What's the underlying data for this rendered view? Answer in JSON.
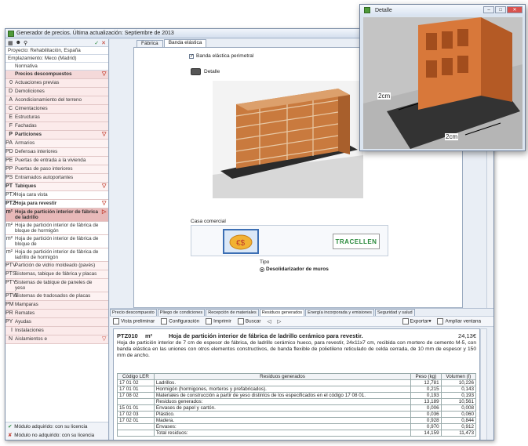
{
  "window": {
    "title": "Generador de precios. Última actualización: Septiembre de 2013"
  },
  "left": {
    "toolbar": {
      "check": "✓",
      "close": "✕"
    },
    "info": [
      {
        "label": "Proyecto: Rehabilitación, España"
      },
      {
        "label": "Emplazamiento: Meco (Madrid)"
      }
    ],
    "rows": [
      {
        "code": "",
        "label": "Normativa",
        "cls": "lvl0"
      },
      {
        "code": "",
        "label": "Precios descompuestos",
        "cls": "lvl1 bold",
        "arrow": "▽"
      },
      {
        "code": "0",
        "label": "Actuaciones previas",
        "cls": "lvl2"
      },
      {
        "code": "D",
        "label": "Demoliciones",
        "cls": "lvl2"
      },
      {
        "code": "A",
        "label": "Acondicionamiento del terreno",
        "cls": "lvl2"
      },
      {
        "code": "C",
        "label": "Cimentaciones",
        "cls": "lvl2"
      },
      {
        "code": "E",
        "label": "Estructuras",
        "cls": "lvl2"
      },
      {
        "code": "F",
        "label": "Fachadas",
        "cls": "lvl2"
      },
      {
        "code": "P",
        "label": "Particiones",
        "cls": "lvl2 bold",
        "arrow": "▽"
      },
      {
        "code": "PA",
        "label": "Armarios",
        "cls": "lvl3"
      },
      {
        "code": "PD",
        "label": "Defensas interiores",
        "cls": "lvl3"
      },
      {
        "code": "PE",
        "label": "Puertas de entrada a la vivienda",
        "cls": "lvl3"
      },
      {
        "code": "PP",
        "label": "Puertas de paso interiores",
        "cls": "lvl3"
      },
      {
        "code": "PS",
        "label": "Entramados autoportantes",
        "cls": "lvl3"
      },
      {
        "code": "PT",
        "label": "Tabiques",
        "cls": "lvl3 bold",
        "arrow": "▽"
      },
      {
        "code": "PTX",
        "label": "Hoja cara vista",
        "cls": "lvl4"
      },
      {
        "code": "PTZ",
        "label": "Hoja para revestir",
        "cls": "lvl4 bold",
        "arrow": "▽"
      },
      {
        "code": "m²",
        "label": "Hoja de partición interior de fábrica de ladrillo",
        "cls": "lvl4 bold sel",
        "arrow": "▷"
      },
      {
        "code": "m²",
        "label": "Hoja de partición interior de fábrica de bloque de hormigón",
        "cls": "lvl4"
      },
      {
        "code": "m²",
        "label": "Hoja de partición interior de fábrica de bloque de",
        "cls": "lvl4"
      },
      {
        "code": "m²",
        "label": "Hoja de partición interior de fábrica de ladrillo de hormigón",
        "cls": "lvl4"
      },
      {
        "code": "PTV",
        "label": "Partición de vidrio moldeado (pavés)",
        "cls": "lvl3"
      },
      {
        "code": "PTS",
        "label": "Sistemas, tabique de fábrica y placas",
        "cls": "lvl3"
      },
      {
        "code": "PTY",
        "label": "Sistemas de tabique de paneles de yeso",
        "cls": "lvl3"
      },
      {
        "code": "PTW",
        "label": "Sistemas de tradosados de placas",
        "cls": "lvl3"
      },
      {
        "code": "PM",
        "label": "Mamparas",
        "cls": "lvl2"
      },
      {
        "code": "PR",
        "label": "Remates",
        "cls": "lvl2"
      },
      {
        "code": "PY",
        "label": "Ayudas",
        "cls": "lvl2"
      },
      {
        "code": "I",
        "label": "Instalaciones",
        "cls": "lvl2"
      },
      {
        "code": "N",
        "label": "Aislamientos e",
        "cls": "lvl2",
        "arrow": "▽"
      }
    ],
    "legend": [
      "Módulo adquirido: con su licencia",
      "Módulo no adquirido: con su licencia"
    ]
  },
  "tabs": [
    "Fábrica",
    "Banda elástica"
  ],
  "panel": {
    "checkbox": "Banda elástica perimetral",
    "detalle": "Detalle",
    "casa": "Casa comercial",
    "tipo": "Tipo",
    "radio": "Desolidarizador de muros",
    "brand": "TRACELLEN"
  },
  "bottom_tabs": [
    "Precio descompuesto",
    "Pliego de condiciones",
    "Recepción de materiales",
    "Residuos generados",
    "Energía incorporada y emisiones",
    "Seguridad y salud"
  ],
  "toolbar": {
    "vista": "Vista preliminar",
    "config": "Configuración",
    "imprimir": "Imprimir",
    "buscar": "Buscar",
    "exportar": "Exportar",
    "ampliar": "Ampliar ventana"
  },
  "doc": {
    "code": "PTZ010",
    "unit": "m²",
    "title": "Hoja de partición interior de fábrica de ladrillo cerámico para revestir.",
    "price": "24,13€",
    "desc": "Hoja de partición interior de 7 cm de espesor de fábrica, de ladrillo cerámico hueco, para revestir, 24x11x7 cm, recibida con mortero de cemento M-5, con banda elástica en las uniones con otros elementos constructivos, de banda flexible de polietileno reticulado de celda cerrada, de 10 mm de espesor y 150 mm de ancho.",
    "headers": [
      "Código LER",
      "Residuos generados",
      "Peso (kg)",
      "Volumen (l)"
    ],
    "rows": [
      [
        "17 01 02",
        "Ladrillos.",
        "12,781",
        "10,226"
      ],
      [
        "17 01 01",
        "Hormigón (hormigones, morteros y prefabricados).",
        "0,215",
        "0,143"
      ],
      [
        "17 08 02",
        "Materiales de construcción a partir de yeso distintos de los especificados en el código 17 08 01.",
        "0,193",
        "0,193"
      ],
      [
        "",
        "Residuos generados:",
        "13,189",
        "10,561"
      ],
      [
        "15 01 01",
        "Envases de papel y cartón.",
        "0,006",
        "0,008"
      ],
      [
        "17 02 03",
        "Plástico.",
        "0,036",
        "0,060"
      ],
      [
        "17 02 01",
        "Madera.",
        "0,928",
        "0,844"
      ],
      [
        "",
        "Envases:",
        "0,970",
        "0,912"
      ],
      [
        "",
        "Total residuos:",
        "14,159",
        "11,473"
      ]
    ]
  },
  "detail_window": {
    "title": "Detalle",
    "dim1": "2cm",
    "dim2": "2cm"
  }
}
